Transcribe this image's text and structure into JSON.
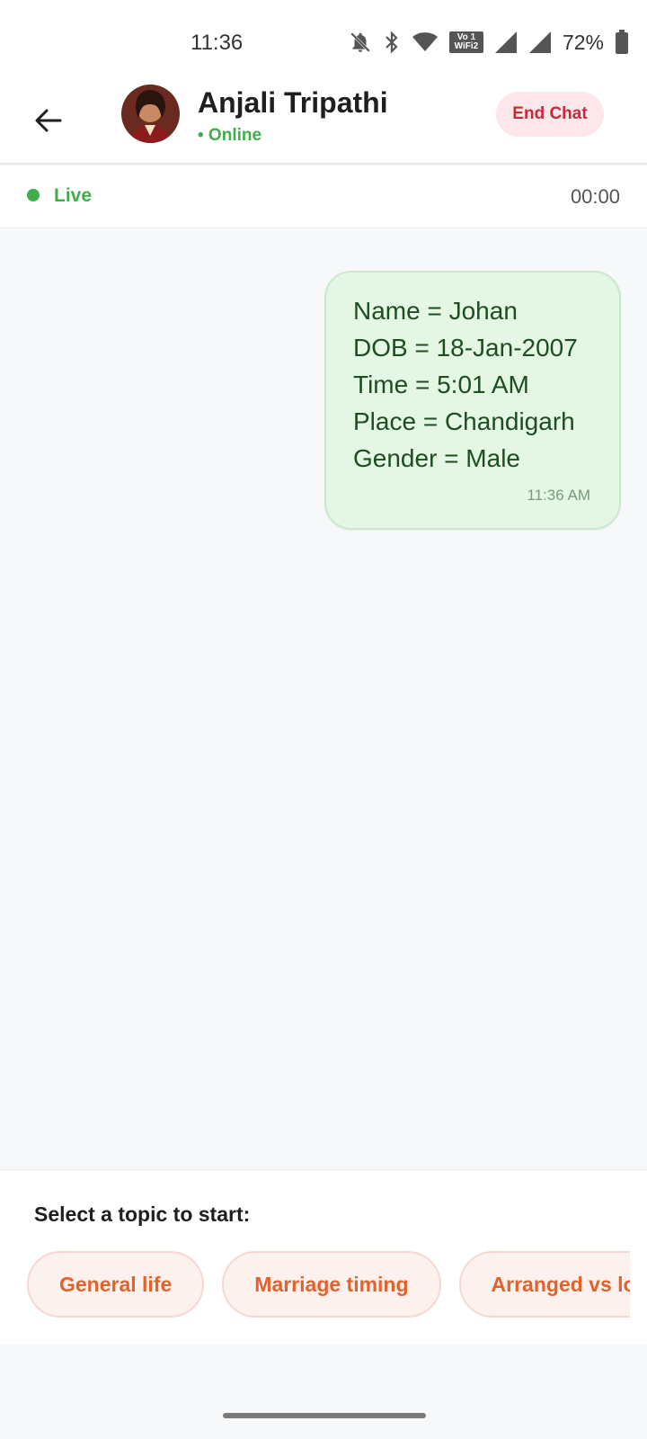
{
  "status_bar": {
    "time": "11:36",
    "wifi_badge": "Vo 1 WiFi2",
    "battery": "72%",
    "icons": [
      "dnd-bell-off-icon",
      "bluetooth-icon",
      "wifi-icon",
      "signal-icon",
      "signal-icon",
      "battery-icon"
    ]
  },
  "header": {
    "back_icon": "arrow-left-icon",
    "contact_name": "Anjali Tripathi",
    "contact_status": "• Online",
    "end_chat_label": "End Chat"
  },
  "live": {
    "label": "Live",
    "timer": "00:00"
  },
  "messages": [
    {
      "lines": [
        "Name = Johan",
        "DOB = 18-Jan-2007",
        "Time = 5:01 AM",
        "Place = Chandigarh",
        "Gender = Male"
      ],
      "time": "11:36 AM"
    }
  ],
  "topics": {
    "title": "Select a topic to start:",
    "chips": [
      "General life",
      "Marriage timing",
      "Arranged vs lo"
    ]
  },
  "colors": {
    "accent_green": "#3fae4a",
    "end_chat_red": "#c62a3a",
    "chip_orange": "#e2622e",
    "bubble_bg": "#e4f7e5"
  }
}
